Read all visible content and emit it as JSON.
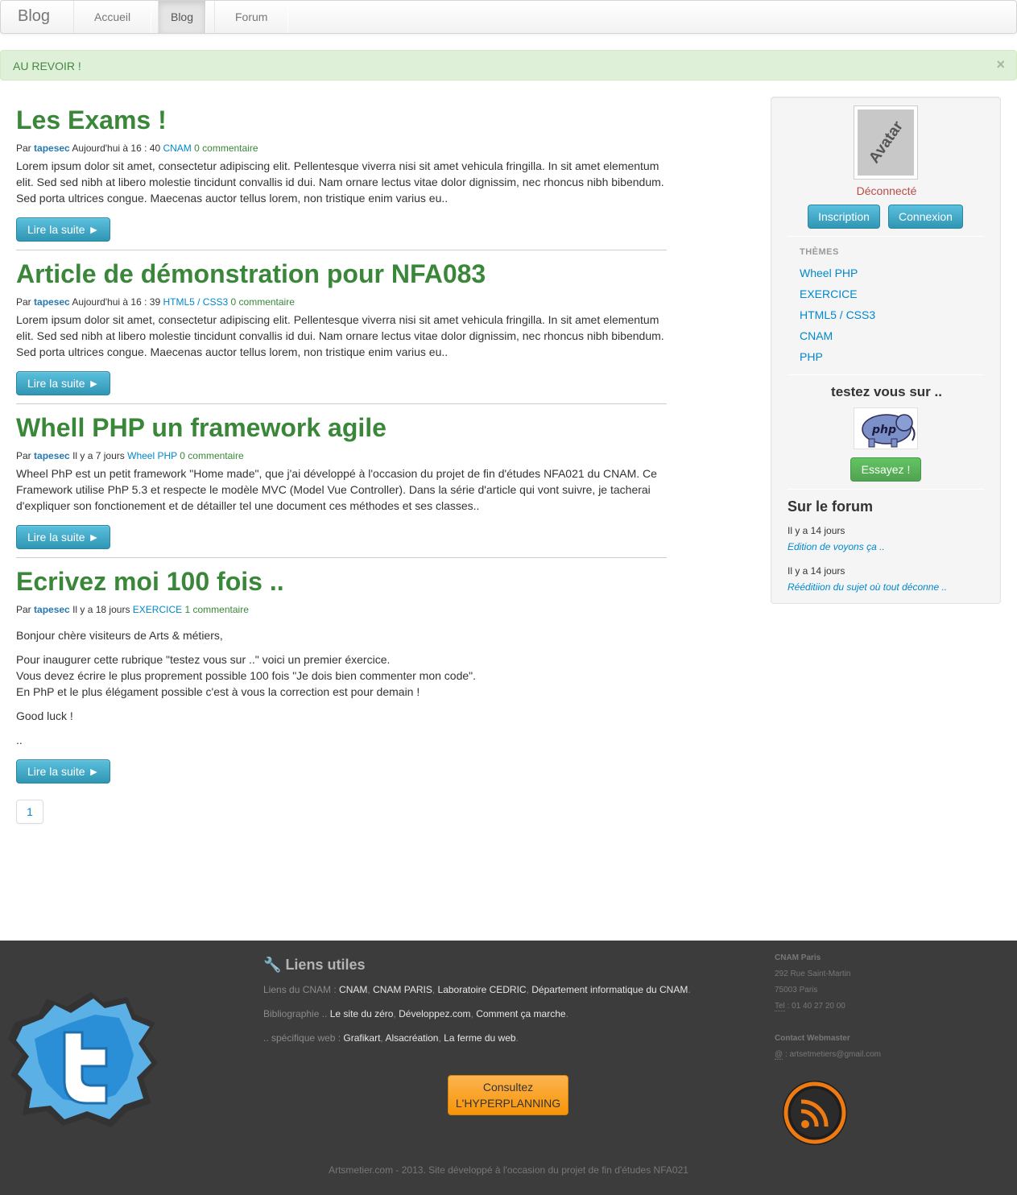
{
  "navbar": {
    "brand": "Blog",
    "items": [
      "Accueil",
      "Blog",
      "Forum"
    ]
  },
  "alert": {
    "text": "AU REVOIR !",
    "close": "×"
  },
  "articles": [
    {
      "title": "Les Exams !",
      "by": "Par",
      "author": "tapesec",
      "date": "Aujourd'hui à 16 : 40",
      "category": "CNAM",
      "comments": "0 commentaire",
      "paragraphs": [
        "Lorem ipsum dolor sit amet, consectetur adipiscing elit. Pellentesque viverra nisi sit amet vehicula fringilla. In sit amet elementum elit. Sed sed nibh at libero molestie tincidunt convallis id dui. Nam ornare lectus vitae dolor dignissim, nec rhoncus nibh bibendum. Sed porta ultrices congue. Maecenas auctor tellus lorem, non tristique enim varius eu.."
      ],
      "read_more": "Lire la suite ►"
    },
    {
      "title": "Article de démonstration pour NFA083",
      "by": "Par",
      "author": "tapesec",
      "date": "Aujourd'hui à 16 : 39",
      "category": "HTML5 / CSS3",
      "comments": "0 commentaire",
      "paragraphs": [
        "Lorem ipsum dolor sit amet, consectetur adipiscing elit. Pellentesque viverra nisi sit amet vehicula fringilla. In sit amet elementum elit. Sed sed nibh at libero molestie tincidunt convallis id dui. Nam ornare lectus vitae dolor dignissim, nec rhoncus nibh bibendum. Sed porta ultrices congue. Maecenas auctor tellus lorem, non tristique enim varius eu.."
      ],
      "read_more": "Lire la suite ►"
    },
    {
      "title": "Whell PHP un framework agile",
      "by": "Par",
      "author": "tapesec",
      "date": "Il y a 7 jours",
      "category": "Wheel PHP",
      "comments": "0 commentaire",
      "paragraphs": [
        "Wheel PhP est un petit framework \"Home made\", que j'ai développé à l'occasion du projet de fin d'études NFA021 du CNAM. Ce Framework utilise PhP 5.3 et respecte le modèle MVC (Model Vue Controller). Dans la série d'article qui vont suivre, je tacherai d'expliquer son fonctionement et de détailler tel une document ces méthodes et ses classes.."
      ],
      "read_more": "Lire la suite ►"
    },
    {
      "title": "Ecrivez moi 100 fois ..",
      "by": "Par",
      "author": "tapesec",
      "date": "Il y a 18 jours",
      "category": "EXERCICE",
      "comments": "1 commentaire",
      "paragraphs": [
        "Bonjour chère visiteurs de Arts & métiers,",
        "Pour inaugurer cette rubrique \"testez vous sur ..\" voici un premier éxercice.",
        "Vous devez écrire le plus proprement possible 100 fois \"Je dois bien commenter mon code\".",
        "En PhP et le plus élégament possible c'est à vous la correction est pour demain !",
        "Good luck !",
        ".."
      ],
      "read_more": "Lire la suite ►"
    }
  ],
  "pagination": {
    "page": "1"
  },
  "sidebar": {
    "avatar_text": "Avatar",
    "status": "Déconnecté",
    "register_label": "Inscription",
    "login_label": "Connexion",
    "themes_header": "THÈMES",
    "themes": [
      "Wheel PHP",
      "EXERCICE",
      "HTML5 / CSS3",
      "CNAM",
      "PHP"
    ],
    "test_title": "testez vous sur ..",
    "php_logo_text": "php",
    "try_label": "Essayez !",
    "forum_title": "Sur le forum",
    "forum_posts": [
      {
        "date": "Il y a 14 jours",
        "title": "Edition de voyons ça .."
      },
      {
        "date": "Il y a 14 jours",
        "title": "Rééditiion du sujet où tout déconne .."
      }
    ]
  },
  "footer": {
    "links_title": "Liens utiles",
    "cnam_label": "Liens du CNAM :",
    "cnam_links": [
      "CNAM",
      "CNAM PARIS",
      "Laboratoire CEDRIC",
      "Département informatique du CNAM"
    ],
    "biblio_label": "Bibliographie ..",
    "biblio_links": [
      "Le site du zéro",
      "Développez.com",
      "Comment ça marche"
    ],
    "web_label": ".. spécifique web :",
    "web_links": [
      "Grafikart",
      "Alsacréation",
      "La ferme du web"
    ],
    "hyperplanning_line1": "Consultez",
    "hyperplanning_line2": "L'HYPERPLANNING",
    "address_title": "CNAM Paris",
    "address_street": "292 Rue Saint-Martin",
    "address_city": "75003 Paris",
    "tel_label": "Tel",
    "tel_value": ": 01 40 27 20 00",
    "contact_title": "Contact Webmaster",
    "email_label": "@",
    "email_value": ": artsetmetiers@gmail.com",
    "copyright": "Artsmetier.com - 2013. Site développé à l'occasion du projet de fin d'études NFA021"
  },
  "colors": {
    "title_green": "#3a873a",
    "link_blue": "#0088cc",
    "footer_bg": "#3c3c3c",
    "alert_bg": "#dff0d8"
  }
}
